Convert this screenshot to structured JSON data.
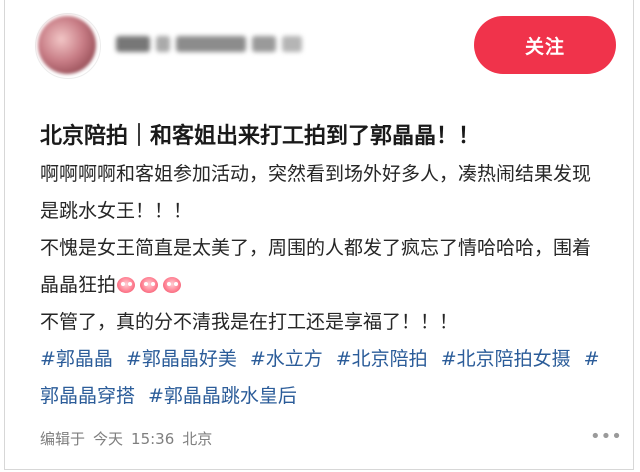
{
  "post": {
    "follow_label": "关注",
    "title": "北京陪拍｜和客姐出来打工拍到了郭晶晶！！",
    "lines": [
      "啊啊啊啊和客姐参加活动，突然看到场外好多人，凑热闹结果发现是跳水女王！！！",
      "不愧是女王简直是太美了，周围的人都发了疯忘了情哈哈哈，围着晶晶狂拍",
      "不管了，真的分不清我是在打工还是享福了！！！"
    ],
    "emoji": [
      "flushed-face-emoji",
      "flushed-face-emoji",
      "flushed-face-emoji"
    ],
    "tags": [
      "#郭晶晶",
      "#郭晶晶好美",
      "#水立方",
      "#北京陪拍",
      "#北京陪拍女摄",
      "#郭晶晶穿搭",
      "#郭晶晶跳水皇后"
    ],
    "meta": {
      "edited_prefix": "编辑于",
      "date": "今天",
      "time": "15:36",
      "location": "北京"
    },
    "more_icon": "more-icon"
  },
  "colors": {
    "accent": "#f0334b",
    "tag": "#2b5c99",
    "meta": "#7f7f7f"
  }
}
